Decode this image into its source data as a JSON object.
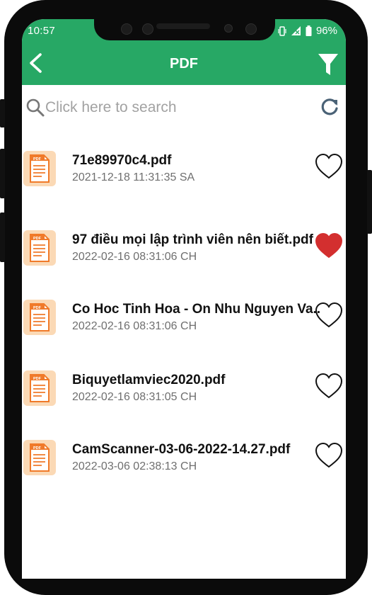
{
  "status_bar": {
    "time": "10:57",
    "battery": "96%"
  },
  "header": {
    "title": "PDF"
  },
  "search": {
    "placeholder": "Click here to search"
  },
  "files": [
    {
      "name": "71e89970c4.pdf",
      "date": "2021-12-18 11:31:35 SA",
      "favorite": false
    },
    {
      "name": "97 điều mọi lập trình viên nên biết.pdf",
      "date": "2022-02-16 08:31:06 CH",
      "favorite": true
    },
    {
      "name": "Co Hoc Tinh Hoa - On Nhu Nguyen Va..",
      "date": "2022-02-16 08:31:06 CH",
      "favorite": false
    },
    {
      "name": "Biquyetlamviec2020.pdf",
      "date": "2022-02-16 08:31:05 CH",
      "favorite": false
    },
    {
      "name": "CamScanner-03-06-2022-14.27.pdf",
      "date": "2022-03-06 02:38:13 CH",
      "favorite": false
    }
  ],
  "icons": {
    "back": "chevron-left-icon",
    "filter": "filter-icon",
    "search": "search-icon",
    "refresh": "refresh-icon",
    "file": "pdf-file-icon",
    "favorite": "heart-icon",
    "pdf_badge": "PDF"
  },
  "colors": {
    "accent": "#27a865",
    "heart_active": "#d32f2f",
    "pdf_icon_bg": "#fbd9b5",
    "pdf_icon_orange": "#f07a2a"
  }
}
